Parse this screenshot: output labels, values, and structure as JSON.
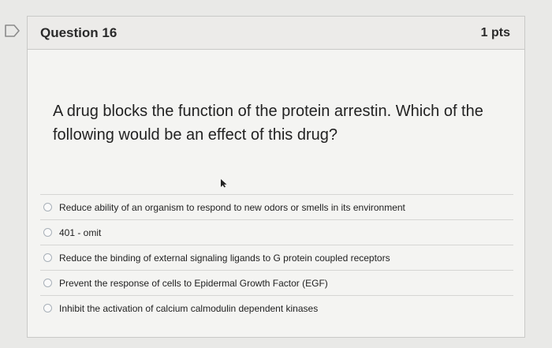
{
  "question": {
    "title": "Question 16",
    "points": "1 pts",
    "text": "A drug blocks the function of the protein arrestin. Which of the following would be an effect of this drug?"
  },
  "answers": [
    {
      "label": "Reduce ability of an organism to respond to new odors or smells in its environment",
      "selected": false
    },
    {
      "label": "401 - omit",
      "selected": false
    },
    {
      "label": "Reduce the binding of external signaling ligands to G protein coupled receptors",
      "selected": false
    },
    {
      "label": "Prevent the response of cells to Epidermal Growth Factor (EGF)",
      "selected": false
    },
    {
      "label": "Inhibit the activation of calcium calmodulin dependent kinases",
      "selected": false
    }
  ],
  "icons": {
    "flag": "flag-icon",
    "cursor": "mouse-cursor-icon"
  }
}
